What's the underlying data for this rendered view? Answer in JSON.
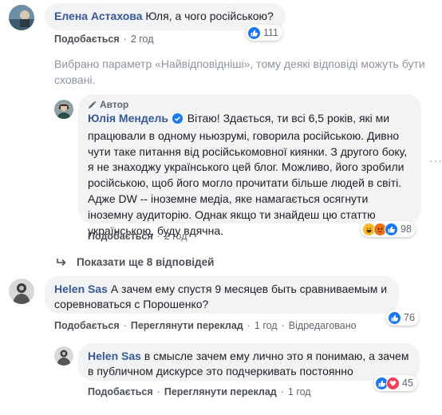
{
  "comments": {
    "c1": {
      "author": "Елена Астахова",
      "text": "Юля, а чого російською?",
      "like_label": "Подобається",
      "time": "2 год",
      "reaction_count": "111"
    },
    "filter_notice": "Вибрано параметр «Найвідповідніші», тому деякі відповіді можуть бути сховані.",
    "reply1": {
      "badge": "Автор",
      "author": "Юлія Мендель",
      "text": "Вітаю! Здається, ти всі 6,5 років, які ми працювали в одному ньюзрумі, говорила російською. Дивно чути таке питання від російськомовної киянки. З другого боку, я не знаходжу українського цей блог. Можливо, його зробили російською, щоб його могло прочитати більше людей в світі. Адже DW -- іноземне медіа, яке намагається осягнути іноземну аудиторію. Однак якщо ти знайдеш цю статтю українською, буду вдячна.",
      "like_label": "Подобається",
      "time": "2 год",
      "reaction_count": "98"
    },
    "show_more": "Показати ще 8 відповідей",
    "c2": {
      "author": "Helen Sas",
      "text": "А зачем ему спустя 9 месяцев быть сравниваемым и соревноваться с Порошенко?",
      "like_label": "Подобається",
      "translate_label": "Переглянути переклад",
      "time": "1 год",
      "edited_label": "Відредаговано",
      "reaction_count": "76"
    },
    "reply2": {
      "author": "Helen Sas",
      "text": "в смысле зачем ему лично это я понимаю, а зачем в публичном дискурсе это подчеркивать постоянно",
      "like_label": "Подобається",
      "translate_label": "Переглянути переклад",
      "time": "1 год",
      "reaction_count": "45"
    }
  },
  "icons": {
    "like": "like-icon",
    "haha": "haha-icon",
    "angry": "angry-icon",
    "love": "love-icon",
    "verified": "verified-badge-icon",
    "author_badge": "pen-icon",
    "reply_arrow": "reply-arrow-icon",
    "more": "more-options-icon"
  },
  "colors": {
    "link": "#385898",
    "like_blue": "#1877f2",
    "bubble": "#f2f3f5",
    "meta_gray": "#606770",
    "haha_yellow": "#f7b928",
    "angry_orange": "#e9710f",
    "love_red": "#f33e58"
  }
}
